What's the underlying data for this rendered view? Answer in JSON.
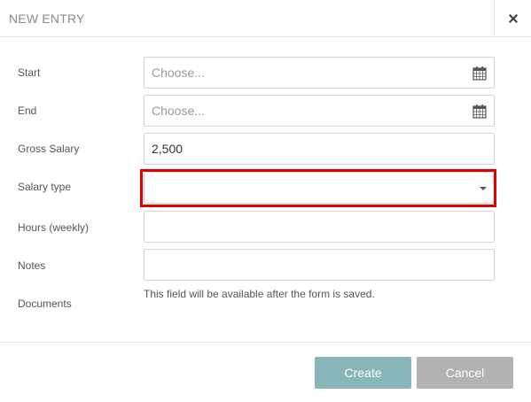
{
  "dialog": {
    "title": "NEW ENTRY",
    "close_icon": "close-icon"
  },
  "form": {
    "start": {
      "label": "Start",
      "placeholder": "Choose...",
      "icon": "calendar-icon"
    },
    "end": {
      "label": "End",
      "placeholder": "Choose...",
      "icon": "calendar-icon"
    },
    "gross_salary": {
      "label": "Gross Salary",
      "value": "2,500"
    },
    "salary_type": {
      "label": "Salary type",
      "value": "",
      "icon": "chevron-down-icon",
      "highlighted": true
    },
    "hours": {
      "label": "Hours (weekly)",
      "value": ""
    },
    "notes": {
      "label": "Notes",
      "value": ""
    },
    "documents": {
      "label": "Documents",
      "helper": "This field will be available after the form is saved."
    }
  },
  "footer": {
    "create_label": "Create",
    "cancel_label": "Cancel"
  },
  "colors": {
    "create_button": "#86b6b7",
    "cancel_button": "#b2b2b2",
    "highlight": "#e00000"
  }
}
